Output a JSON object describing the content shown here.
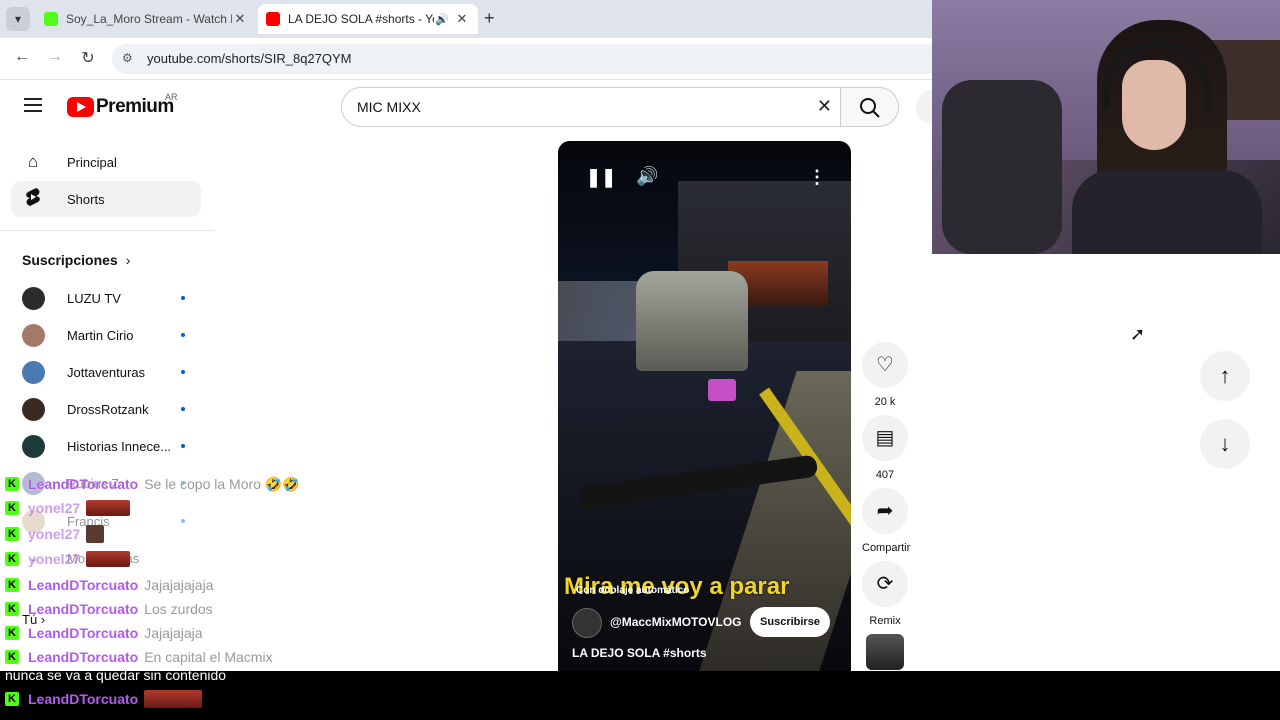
{
  "browser": {
    "tabs": [
      {
        "title": "Soy_La_Moro Stream - Watch L",
        "favicon_color": "#53fc18",
        "active": false
      },
      {
        "title": "LA DEJO SOLA #shorts - Yo",
        "favicon_color": "#ff0000",
        "active": true
      }
    ],
    "url": "youtube.com/shorts/SIR_8q27QYM"
  },
  "youtube": {
    "logo_text": "Premium",
    "region": "AR",
    "search_value": "MIC MIXX",
    "sidebar": {
      "items": [
        {
          "label": "Principal",
          "icon": "home-icon"
        },
        {
          "label": "Shorts",
          "icon": "shorts-icon",
          "active": true
        }
      ],
      "subscriptions_title": "Suscripciones",
      "subscriptions": [
        {
          "name": "LUZU TV",
          "color": "#2b2b2b"
        },
        {
          "name": "Martin Cirio",
          "color": "#a27a6a"
        },
        {
          "name": "Jottaventuras",
          "color": "#4a7ab0"
        },
        {
          "name": "DrossRotzank",
          "color": "#3a2a22"
        },
        {
          "name": "Historias Innece...",
          "color": "#1e3a3a"
        },
        {
          "name": "Rubius Z",
          "color": "#5a6aa0"
        },
        {
          "name": "Francis",
          "color": "#c8b090"
        },
        {
          "name": "Mostrar más",
          "color": "#ffffff"
        }
      ],
      "you_label": "Tú"
    },
    "short": {
      "caption_overlay": "Mira me voy a parar",
      "auto_dub": "Con doblaje automático",
      "channel": "@MaccMixMOTOVLOG",
      "subscribe_label": "Suscribirse",
      "title": "LA DEJO SOLA",
      "hashtag": "#shorts"
    },
    "actions": [
      {
        "icon": "heart-icon",
        "label": "20 k"
      },
      {
        "icon": "comment-icon",
        "label": "407"
      },
      {
        "icon": "share-icon",
        "label": "Compartir"
      },
      {
        "icon": "remix-icon",
        "label": "Remix"
      }
    ]
  },
  "chat": [
    {
      "user": "LeandDTorcuato",
      "text": "Se le copo la Moro 🤣🤣"
    },
    {
      "user": "yonel27",
      "text": ""
    },
    {
      "user": "yonel27",
      "text": ""
    },
    {
      "user": "yonel27",
      "text": ""
    },
    {
      "user": "LeandDTorcuato",
      "text": "Jajajajajaja"
    },
    {
      "user": "LeandDTorcuato",
      "text": "Los zurdos"
    },
    {
      "user": "LeandDTorcuato",
      "text": "Jajajajaja"
    },
    {
      "user": "LeandDTorcuato",
      "text": "En capital el Macmix"
    },
    {
      "user": "",
      "text": "nunca se va a quedar sin contenido"
    },
    {
      "user": "LeandDTorcuato",
      "text": ""
    }
  ]
}
